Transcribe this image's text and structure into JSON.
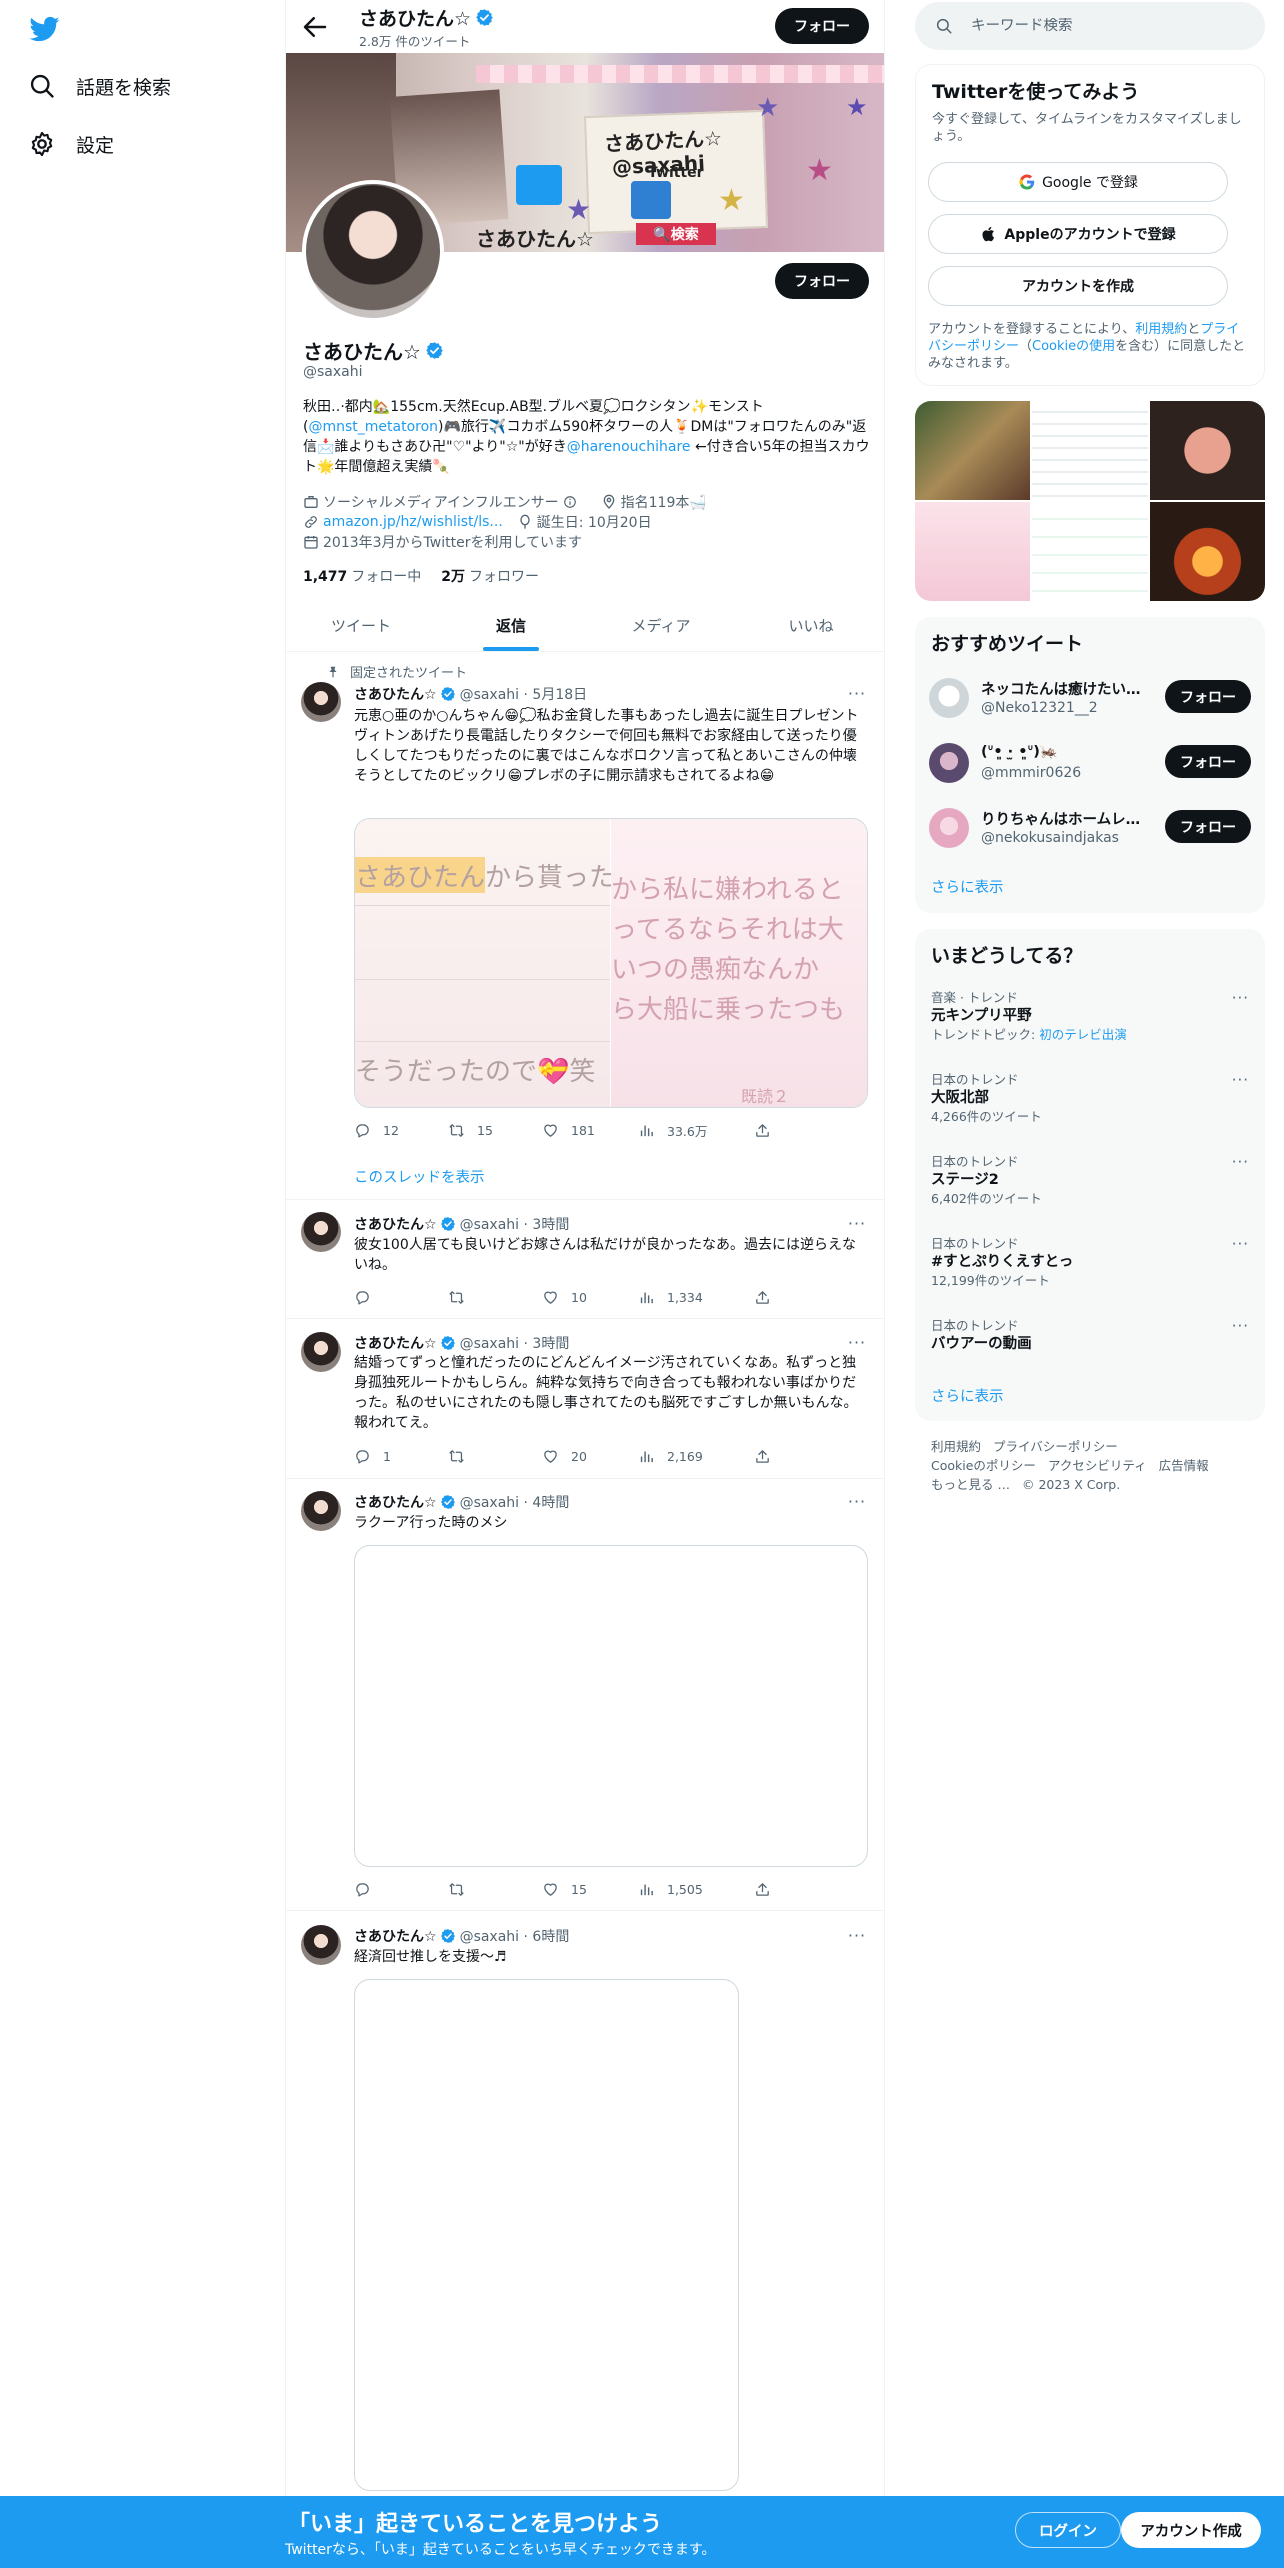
{
  "nav": {
    "explore_label": "話題を検索",
    "settings_label": "設定"
  },
  "header": {
    "name": "さあひたん☆",
    "tweet_count": "2.8万 件のツイート",
    "follow_label": "フォロー"
  },
  "profile": {
    "name": "さあひたん☆",
    "handle": "@saxahi",
    "follow_label": "フォロー",
    "bio_line1": "秋田‥·都内🏡155cm.天然Ecup.AB型.ブルベ夏💭ロクシタン✨モンスト(",
    "bio_link1": "@mnst_metatoron",
    "bio_line2": ")🎮旅行✈️コカボム590杯タワーの人🍹DMは\"フォロワたんのみ\"返信📩誰よりもさあひ卍\"♡\"より\"☆\"が好き",
    "bio_link2": "@harenouchihare",
    "bio_line3": " ←付き合い5年の担当スカウト🌟年間億超え実績🍡",
    "category": "ソーシャルメディアインフルエンサー",
    "location": "指名119本🛁",
    "website": "amazon.jp/hz/wishlist/ls...",
    "birthday": "誕生日: 10月20日",
    "joined": "2013年3月からTwitterを利用しています",
    "following_count": "1,477",
    "following_label": "フォロー中",
    "followers_count": "2万",
    "followers_label": "フォロワー"
  },
  "banner": {
    "name_text": "さあひたん☆",
    "handle_text": "@saxahi",
    "twitter_text": "Twitter",
    "search_text": "🔍検索",
    "bottom_name": "さあひたん☆"
  },
  "tabs": [
    {
      "label": "ツイート",
      "active": false
    },
    {
      "label": "返信",
      "active": true
    },
    {
      "label": "メディア",
      "active": false
    },
    {
      "label": "いいね",
      "active": false
    }
  ],
  "tweets": [
    {
      "pinned_label": "固定されたツイート",
      "name": "さあひたん☆",
      "meta": "@saxahi · 5月18日",
      "text": "元恵○亜のか○んちゃん😁💭私お金貸した事もあったし過去に誕生日プレゼントヴィトンあげたり長電話したりタクシーで何回も無料でお家経由して送ったり優しくしてたつもりだったのに裏ではこんなボロクソ言って私とあいこさんの仲壊そうとしてたのビックリ😁プレボの子に開示請求もされてるよね😁",
      "media_text": {
        "l1": "さあひたんから貰った",
        "l2": "そうだったので💝笑",
        "r1": "から私に嫌われると",
        "r2": "ってるならそれは大",
        "r3": "いつの愚痴なんか",
        "r4": "ら大船に乗ったつも",
        "r5": "既読２"
      },
      "replies": "12",
      "retweets": "15",
      "likes": "181",
      "views": "33.6万",
      "show_thread": "このスレッドを表示"
    },
    {
      "name": "さあひたん☆",
      "meta": "@saxahi · 3時間",
      "text": "彼女100人居ても良いけどお嫁さんは私だけが良かったなあ。過去には逆らえないね。",
      "replies": "",
      "retweets": "",
      "likes": "10",
      "views": "1,334"
    },
    {
      "name": "さあひたん☆",
      "meta": "@saxahi · 3時間",
      "text": "結婚ってずっと憧れだったのにどんどんイメージ汚されていくなあ。私ずっと独身孤独死ルートかもしらん。純粋な気持ちで向き合っても報われない事ばかりだった。私のせいにされたのも隠し事されてたのも脳死ですごすしか無いもんな。報われてえ。",
      "replies": "1",
      "retweets": "",
      "likes": "20",
      "views": "2,169"
    },
    {
      "name": "さあひたん☆",
      "meta": "@saxahi · 4時間",
      "text": "ラクーア行った時のメシ",
      "replies": "",
      "retweets": "",
      "likes": "15",
      "views": "1,505"
    },
    {
      "name": "さあひたん☆",
      "meta": "@saxahi · 6時間",
      "text": "経済回せ推しを支援〜♬"
    }
  ],
  "sidebar": {
    "search_placeholder": "キーワード検索",
    "signup": {
      "title": "Twitterを使ってみよう",
      "subtitle": "今すぐ登録して、タイムラインをカスタマイズしましょう。",
      "google_label": "Google で登録",
      "apple_label": "Appleのアカウントで登録",
      "create_label": "アカウントを作成",
      "terms_prefix": "アカウントを登録することにより、",
      "terms_link1": "利用規約",
      "terms_mid1": "と",
      "terms_link2": "プライバシーポリシー",
      "terms_mid2": "（",
      "terms_link3": "Cookieの使用",
      "terms_suffix": "を含む）に同意したとみなされます。"
    },
    "recommended": {
      "title": "おすすめツイート",
      "users": [
        {
          "name": "ネッコたんは癒けたいネッコたん",
          "handle": "@Neko12321__2",
          "follow_label": "フォロー"
        },
        {
          "name": "(ᐡ•͈ ·̫ •͈ᐡ)🦗",
          "handle": "@mmmir0626",
          "follow_label": "フォロー"
        },
        {
          "name": "りりちゃんはホームレス中",
          "handle": "@nekokusaindjakas",
          "follow_label": "フォロー"
        }
      ],
      "show_more": "さらに表示"
    },
    "trends": {
      "title": "いまどうしてる？",
      "items": [
        {
          "category": "音楽 · トレンド",
          "name": "元キンプリ平野",
          "sub_prefix": "トレンドトピック: ",
          "sub_link": "初のテレビ出演"
        },
        {
          "category": "日本のトレンド",
          "name": "大阪北部",
          "sub_prefix": "4,266件のツイート",
          "sub_link": ""
        },
        {
          "category": "日本のトレンド",
          "name": "ステージ2",
          "sub_prefix": "6,402件のツイート",
          "sub_link": ""
        },
        {
          "category": "日本のトレンド",
          "name": "#すとぷりくえすとっ",
          "sub_prefix": "12,199件のツイート",
          "sub_link": ""
        },
        {
          "category": "日本のトレンド",
          "name": "バウアーの動画",
          "sub_prefix": "",
          "sub_link": ""
        }
      ],
      "show_more": "さらに表示"
    },
    "footer": {
      "terms": "利用規約",
      "privacy": "プライバシーポリシー",
      "cookie": "Cookieのポリシー",
      "accessibility": "アクセシビリティ",
      "ads": "広告情報",
      "more": "もっと見る …",
      "copyright": "© 2023 X Corp."
    }
  },
  "bottombar": {
    "title": "「いま」起きていることを見つけよう",
    "subtitle": "Twitterなら、「いま」起きていることをいち早くチェックできます。",
    "login_label": "ログイン",
    "signup_label": "アカウント作成"
  },
  "colors": {
    "accent": "#1d9bf0",
    "text": "#0f1419",
    "muted": "#536471",
    "border": "#eff3f4"
  }
}
